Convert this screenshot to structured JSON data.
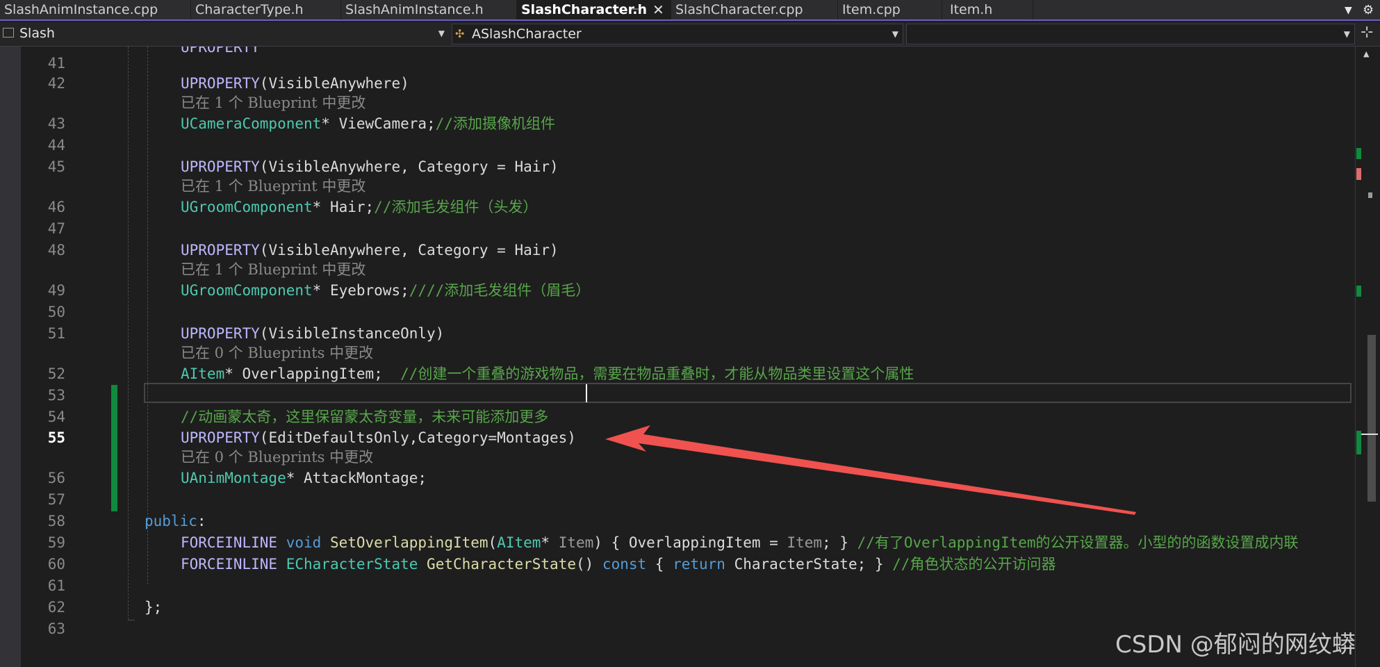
{
  "tabs": [
    {
      "label": "SlashAnimInstance.cpp"
    },
    {
      "label": "CharacterType.h"
    },
    {
      "label": "SlashAnimInstance.h"
    },
    {
      "label": "SlashCharacter.h"
    },
    {
      "label": "SlashCharacter.cpp"
    },
    {
      "label": "Item.cpp"
    },
    {
      "label": "Item.h"
    }
  ],
  "active_tab": "SlashCharacter.h",
  "nav": {
    "project": "Slash",
    "class_scope": "ASlashCharacter",
    "member_scope": ""
  },
  "codelens": {
    "blueprint_1": "已在 1 个 Blueprint 中更改",
    "blueprints_0": "已在 0 个 Blueprints 中更改"
  },
  "line_numbers": [
    "41",
    "42",
    "43",
    "44",
    "45",
    "46",
    "47",
    "48",
    "49",
    "50",
    "51",
    "52",
    "53",
    "54",
    "55",
    "56",
    "57",
    "58",
    "59",
    "60",
    "61",
    "62",
    "63"
  ],
  "code": {
    "l42": {
      "macro": "UPROPERTY",
      "args": "(VisibleAnywhere)"
    },
    "l43": {
      "type": "UCameraComponent",
      "rest": "* ViewCamera;",
      "comment": "//添加摄像机组件"
    },
    "l45": {
      "macro": "UPROPERTY",
      "args": "(VisibleAnywhere, Category = Hair)"
    },
    "l46": {
      "type": "UGroomComponent",
      "rest": "* Hair;",
      "comment": "//添加毛发组件（头发）"
    },
    "l48": {
      "macro": "UPROPERTY",
      "args": "(VisibleAnywhere, Category = Hair)"
    },
    "l49": {
      "type": "UGroomComponent",
      "rest": "* Eyebrows;",
      "comment": "////添加毛发组件（眉毛）"
    },
    "l51": {
      "macro": "UPROPERTY",
      "args": "(VisibleInstanceOnly)"
    },
    "l52": {
      "type": "AItem",
      "rest": "* OverlappingItem;  ",
      "comment": "//创建一个重叠的游戏物品，需要在物品重叠时，才能从物品类里设置这个属性"
    },
    "l54": {
      "comment": "//动画蒙太奇，这里保留蒙太奇变量，未来可能添加更多"
    },
    "l55": {
      "macro": "UPROPERTY",
      "args": "(EditDefaultsOnly,Category=Montages)"
    },
    "l56": {
      "type": "UAnimMontage",
      "rest": "* AttackMontage;"
    },
    "l58": {
      "kw": "public",
      "rest": ":"
    },
    "l59": {
      "macro": "FORCEINLINE",
      "kw": "void",
      "fn": "SetOverlappingItem",
      "p1": "(",
      "type": "AItem",
      "p2": "* ",
      "param": "Item",
      "p3": ") { OverlappingItem = ",
      "param2": "Item",
      "p4": "; } ",
      "comment": "//有了OverlappingItem的公开设置器。小型的的函数设置成内联"
    },
    "l60": {
      "macro": "FORCEINLINE",
      "type": "ECharacterState",
      "fn": "GetCharacterState",
      "p1": "() ",
      "kw": "const",
      "p2": " { ",
      "kw2": "return",
      "p3": " CharacterState; } ",
      "comment": "//角色状态的公开访问器"
    },
    "l62": {
      "rest": "};"
    }
  },
  "watermark": "CSDN @郁闷的网纹蟒",
  "colors": {
    "editor_bg": "#1e1e1e",
    "macro": "#beb7ff",
    "type": "#4ec9b0",
    "keyword": "#569cd6",
    "comment": "#57a64a",
    "function": "#dcdcaa",
    "change_bar": "#108a3e",
    "arrow": "#f0524f",
    "tab_accent": "#6c5fc7"
  }
}
